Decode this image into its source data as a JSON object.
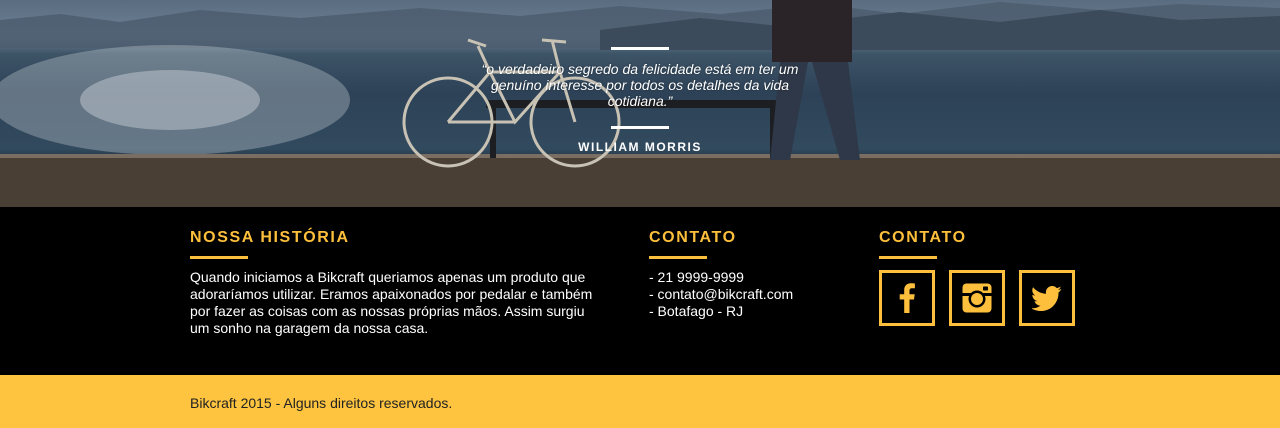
{
  "quote": {
    "text": "“o verdadeiro segredo da felicidade está em ter um genuíno interesse por todos os detalhes da vida cotidiana.”",
    "author": "WILLIAM MORRIS"
  },
  "footer": {
    "history": {
      "title": "NOSSA HISTÓRIA",
      "text": "Quando iniciamos a Bikcraft queriamos apenas um produto que adoraríamos utilizar. Eramos apaixonados por pedalar e também por fazer as coisas com as nossas próprias mãos. Assim surgiu um sonho na garagem da nossa casa."
    },
    "contact": {
      "title": "CONTATO",
      "items": [
        "- 21 9999-9999",
        "- contato@bikcraft.com",
        "- Botafago - RJ"
      ]
    },
    "social": {
      "title": "CONTATO",
      "icons": [
        "facebook-icon",
        "instagram-icon",
        "twitter-icon"
      ]
    }
  },
  "copyright": "Bikcraft 2015 - Alguns direitos reservados.",
  "colors": {
    "accent": "#fec03c",
    "copyright_bg": "#fec43f"
  }
}
